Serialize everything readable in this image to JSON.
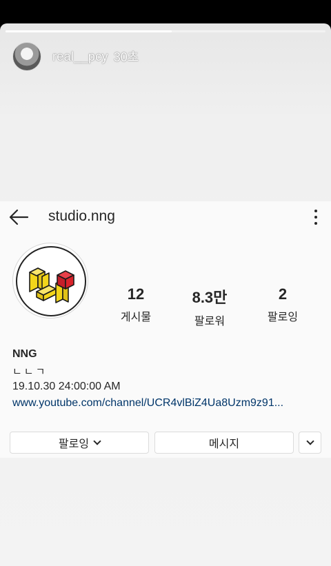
{
  "story": {
    "username": "real__pcy",
    "time": "30초",
    "progress": 0.52
  },
  "profile": {
    "username": "studio.nng",
    "stats": [
      {
        "value": "12",
        "label": "게시물"
      },
      {
        "value": "8.3만",
        "label": "팔로워"
      },
      {
        "value": "2",
        "label": "팔로잉"
      }
    ],
    "display_name": "NNG",
    "bio": "ㄴㄴㄱ",
    "date_text": "19.10.30 24:00:00 AM",
    "link": "www.youtube.com/channel/UCR4vlBiZ4Ua8Uzm9z91..."
  },
  "buttons": {
    "following": "팔로잉",
    "message": "메시지"
  },
  "colors": {
    "link": "#003569",
    "text": "#262626",
    "logo_yellow": "#f2d51b",
    "logo_red": "#d9232b"
  },
  "icons": [
    "back-arrow-icon",
    "more-options-icon",
    "chevron-down-icon"
  ]
}
